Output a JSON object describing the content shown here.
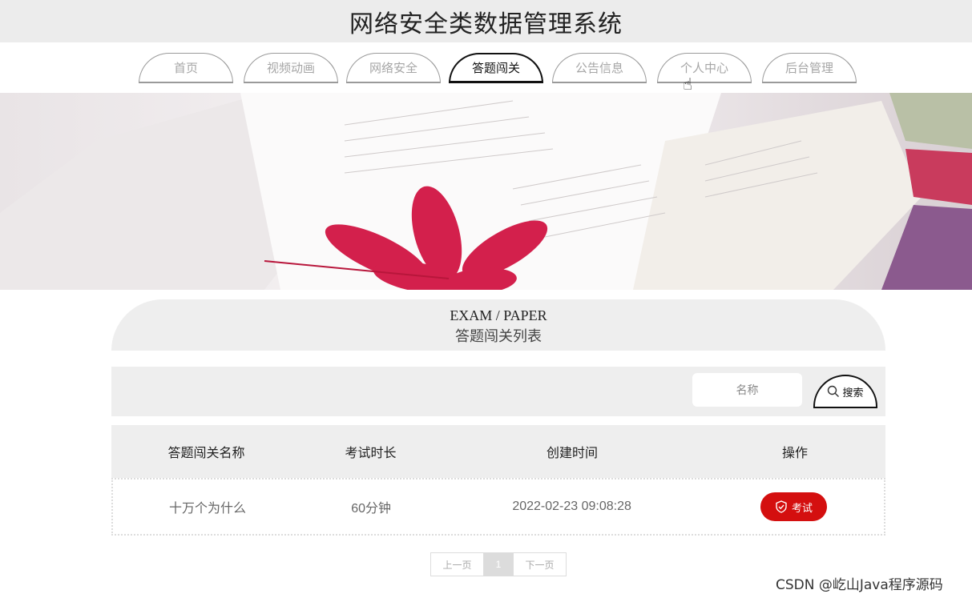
{
  "header": {
    "title": "网络安全类数据管理系统"
  },
  "nav": {
    "items": [
      {
        "label": "首页"
      },
      {
        "label": "视频动画"
      },
      {
        "label": "网络安全"
      },
      {
        "label": "答题闯关"
      },
      {
        "label": "公告信息"
      },
      {
        "label": "个人中心"
      },
      {
        "label": "后台管理"
      }
    ],
    "active": "答题闯关"
  },
  "section": {
    "title_en": "EXAM / PAPER",
    "title_cn": "答题闯关列表"
  },
  "search": {
    "placeholder": "名称",
    "button_label": "搜索"
  },
  "table": {
    "columns": [
      "答题闯关名称",
      "考试时长",
      "创建时间",
      "操作"
    ],
    "rows": [
      {
        "name": "十万个为什么",
        "duration": "60分钟",
        "created": "2022-02-23 09:08:28",
        "action": "考试"
      }
    ]
  },
  "pagination": {
    "prev": "上一页",
    "current": "1",
    "next": "下一页"
  },
  "watermark": "CSDN @屹山Java程序源码",
  "colors": {
    "accent": "#d40f0f",
    "panel": "#eeeeee"
  }
}
